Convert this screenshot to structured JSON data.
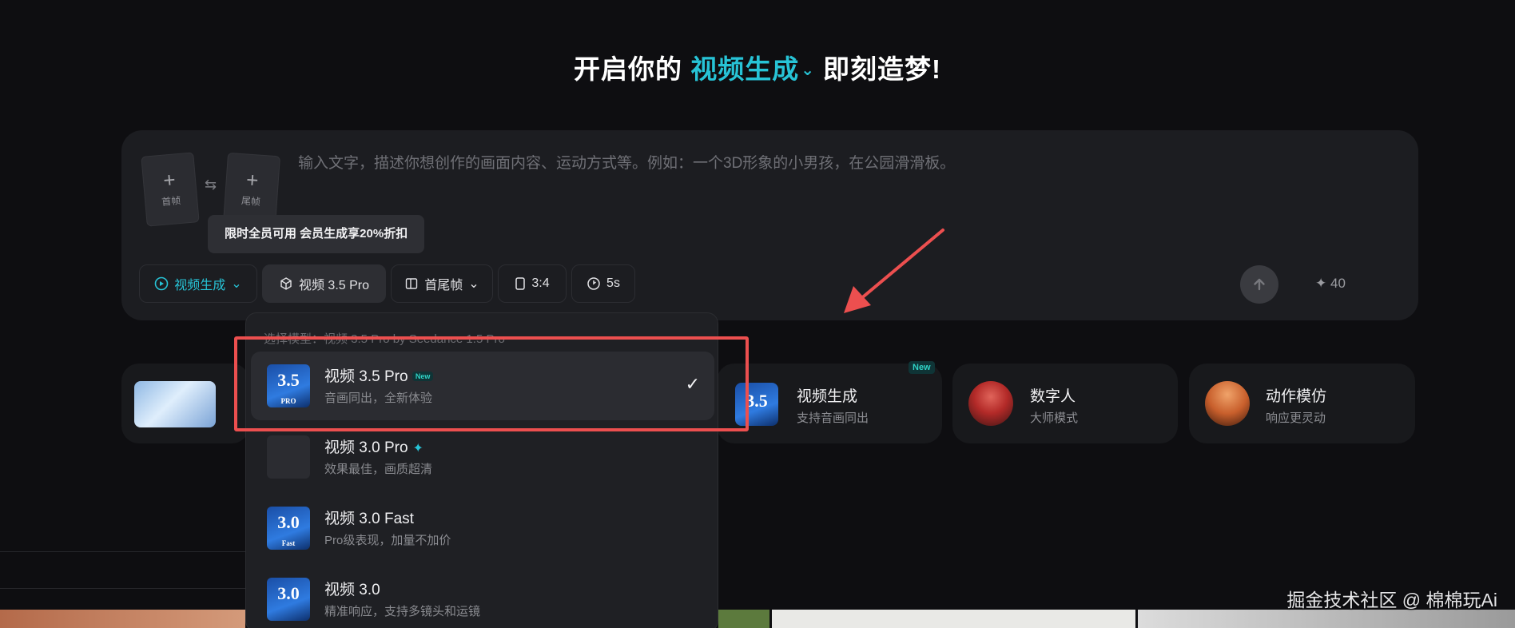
{
  "headline": {
    "prefix": "开启你的",
    "mode": "视频生成",
    "suffix": "即刻造梦!"
  },
  "composer": {
    "first_frame_label": "首帧",
    "last_frame_label": "尾帧",
    "prompt_placeholder": "输入文字，描述你想创作的画面内容、运动方式等。例如：一个3D形象的小男孩，在公园滑滑板。",
    "tooltip": "限时全员可用 会员生成享20%折扣",
    "toolbar": {
      "mode_label": "视频生成",
      "model_label": "视频 3.5 Pro",
      "frame_mode_label": "首尾帧",
      "ratio_label": "3:4",
      "duration_label": "5s"
    },
    "credits": "40"
  },
  "dropdown": {
    "header": "选择模型：视频 3.5 Pro by Seedance 1.5 Pro",
    "items": [
      {
        "title": "视频 3.5 Pro",
        "badge": "New",
        "subtitle": "音画同出，全新体验",
        "thumb_text": "3.5",
        "thumb_sub": "PRO",
        "selected": true
      },
      {
        "title": "视频 3.0 Pro",
        "subtitle": "效果最佳，画质超清",
        "thumb_text": "",
        "thumb_sub": ""
      },
      {
        "title": "视频 3.0 Fast",
        "subtitle": "Pro级表现，加量不加价",
        "thumb_text": "3.0",
        "thumb_sub": "Fast"
      },
      {
        "title": "视频 3.0",
        "subtitle": "精准响应，支持多镜头和运镜",
        "thumb_text": "3.0",
        "thumb_sub": ""
      }
    ]
  },
  "cards": [
    {
      "title": "视频生成",
      "subtitle": "支持音画同出",
      "badge": "New",
      "thumb_text": "3.5",
      "thumb_sub": "PRO"
    },
    {
      "title": "数字人",
      "subtitle": "大师模式"
    },
    {
      "title": "动作模仿",
      "subtitle": "响应更灵动"
    }
  ],
  "watermark": "掘金技术社区 @ 棉棉玩Ai",
  "colors": {
    "accent": "#27c3d6",
    "highlight": "#ec4f4f",
    "background": "#0e0e11"
  }
}
